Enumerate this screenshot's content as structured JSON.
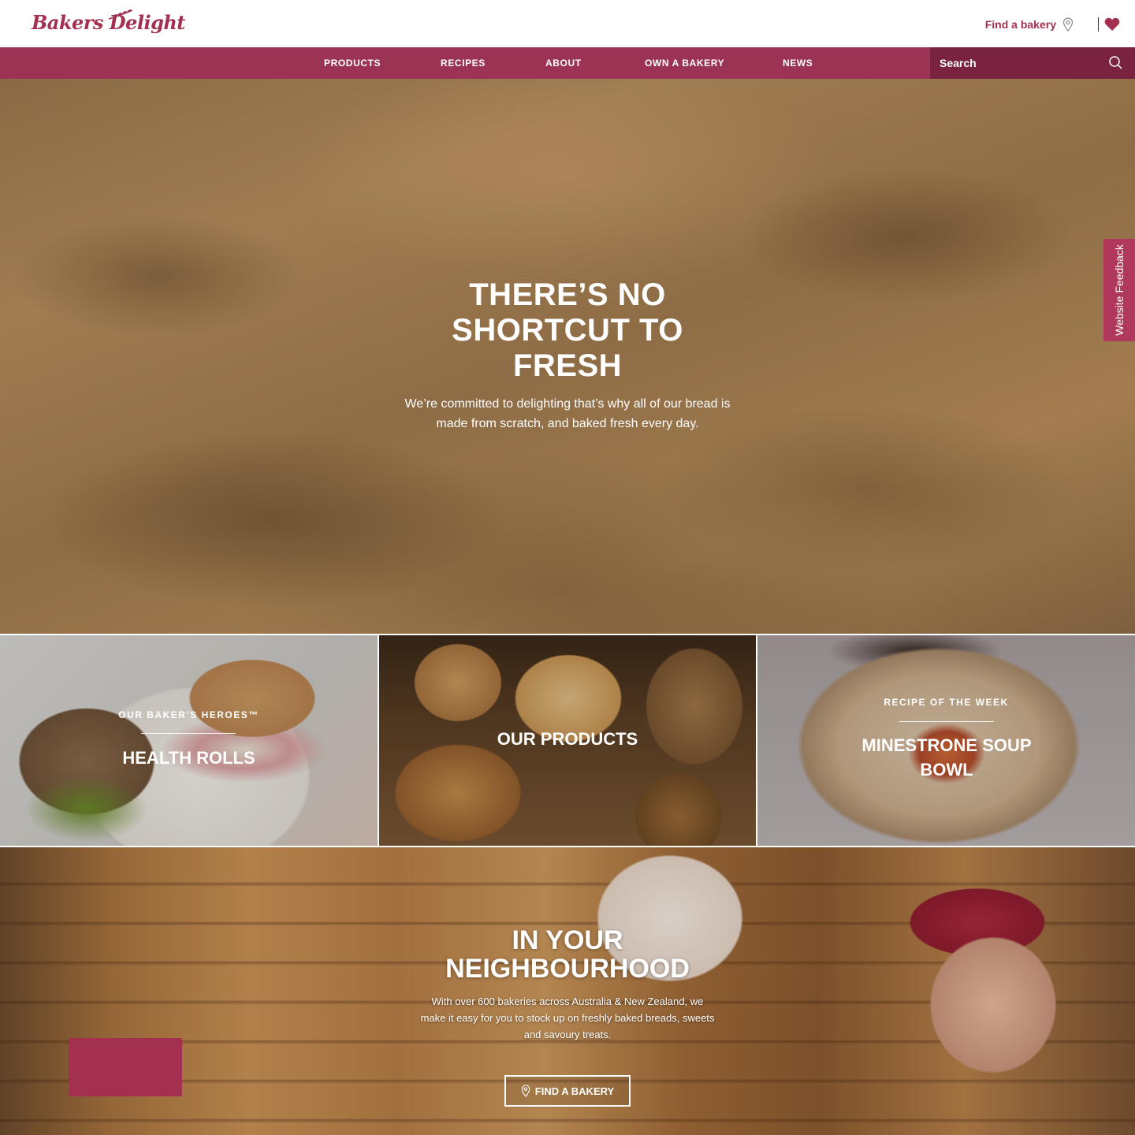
{
  "header": {
    "logo_text": "Bakers Delight",
    "find_bakery_label": "Find a bakery"
  },
  "nav": {
    "items": [
      {
        "label": "PRODUCTS"
      },
      {
        "label": "RECIPES"
      },
      {
        "label": "ABOUT"
      },
      {
        "label": "OWN A BAKERY"
      },
      {
        "label": "NEWS"
      }
    ],
    "search_placeholder": "Search"
  },
  "hero": {
    "title": "THERE’S NO SHORTCUT TO FRESH",
    "subtitle": "We’re committed to delighting that’s why all of our bread is made from scratch, and baked fresh every day."
  },
  "feedback": {
    "label": "Website Feedback"
  },
  "tiles": [
    {
      "kicker": "OUR BAKER’S HEROES™",
      "title": "HEALTH ROLLS"
    },
    {
      "kicker": "",
      "title": "OUR PRODUCTS"
    },
    {
      "kicker": "RECIPE OF THE WEEK",
      "title": "MINESTRONE SOUP BOWL"
    }
  ],
  "neighbourhood": {
    "title": "IN YOUR NEIGHBOURHOOD",
    "subtitle": "With over 600 bakeries across Australia & New Zealand, we make it easy for you to stock up on freshly baked breads, sweets and savoury treats.",
    "button_label": "FIND A BAKERY"
  },
  "colors": {
    "brand": "#9b3354",
    "brand_dark": "#7a2341",
    "feedback": "#b0385c"
  },
  "icons": [
    "wheat-icon",
    "location-pin-icon",
    "heart-icon",
    "search-icon"
  ]
}
